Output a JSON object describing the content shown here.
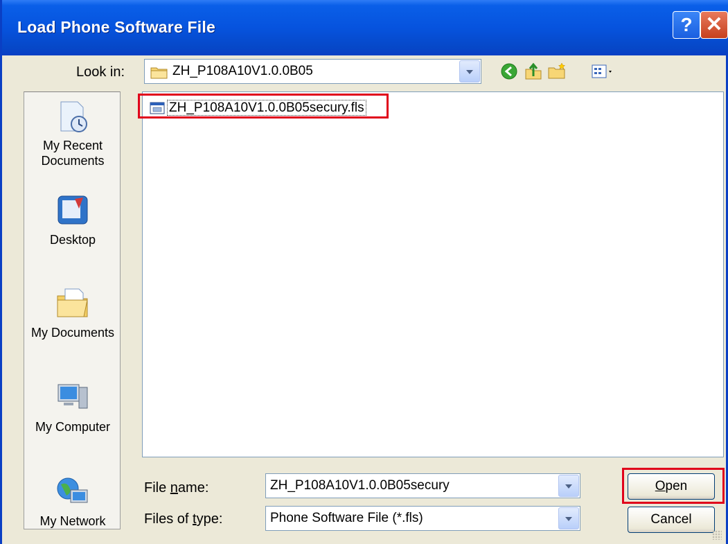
{
  "window": {
    "title": "Load Phone Software File",
    "help_button": "?",
    "close_button": "✕"
  },
  "look_in": {
    "label": "Look in:",
    "value": "ZH_P108A10V1.0.0B05"
  },
  "toolbar": {
    "icons": [
      "back-icon",
      "up-folder-icon",
      "new-folder-icon",
      "views-menu-icon"
    ]
  },
  "places": {
    "items": [
      {
        "label": "My Recent Documents",
        "line1": "My Recent",
        "line2": "Documents",
        "icon": "recent-documents-icon"
      },
      {
        "label": "Desktop",
        "icon": "desktop-icon"
      },
      {
        "label": "My Documents",
        "icon": "my-documents-icon"
      },
      {
        "label": "My Computer",
        "icon": "my-computer-icon"
      },
      {
        "label": "My Network",
        "icon": "my-network-icon"
      }
    ]
  },
  "file_list": {
    "items": [
      {
        "name": "ZH_P108A10V1.0.0B05secury.fls",
        "icon": "fls-file-icon",
        "highlighted": true
      }
    ]
  },
  "file_name": {
    "label": "File name:",
    "value": "ZH_P108A10V1.0.0B05secury"
  },
  "file_type": {
    "label": "Files of type:",
    "value": "Phone Software File (*.fls)"
  },
  "buttons": {
    "open": "Open",
    "cancel": "Cancel"
  },
  "colors": {
    "titlebar": "#0653de",
    "highlight_box": "#e0001b",
    "dialog_bg": "#ece9d8"
  }
}
